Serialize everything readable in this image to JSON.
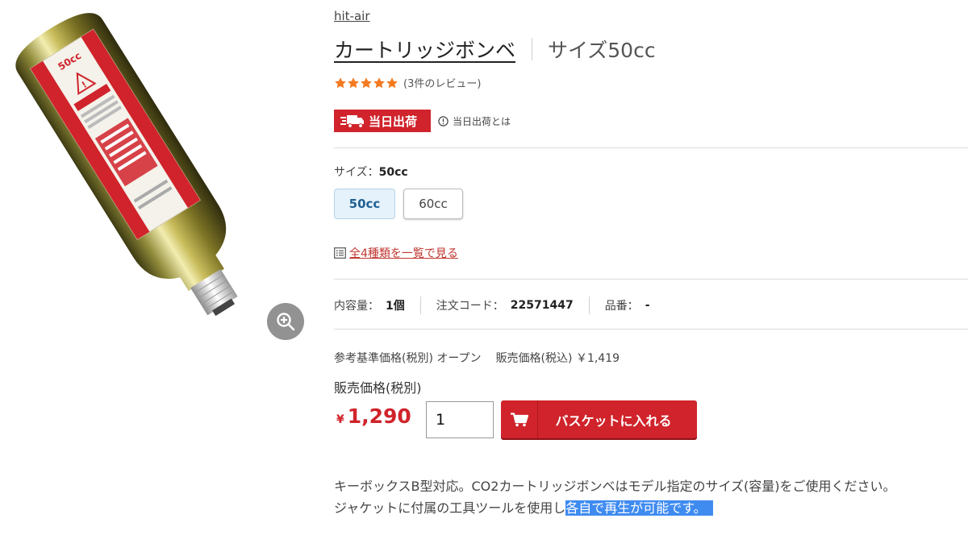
{
  "brand": "hit-air",
  "product": {
    "name": "カートリッジボンベ",
    "variant": "サイズ50cc",
    "image_alt": "CO2カートリッジボンベ"
  },
  "rating": {
    "stars": 5,
    "review_text": "(3件のレビュー)",
    "star_color": "#f47a1f"
  },
  "shipping": {
    "badge": "当日出荷",
    "help": "当日出荷とは",
    "badge_color": "#d0232b"
  },
  "size": {
    "label": "サイズ：",
    "selected": "50cc",
    "options": [
      "50cc",
      "60cc"
    ]
  },
  "all_variants_link": "全4種類を一覧で見る",
  "specs": [
    {
      "label": "内容量：",
      "value": "1個"
    },
    {
      "label": "注文コード：",
      "value": "22571447"
    },
    {
      "label": "品番：",
      "value": "-"
    }
  ],
  "reference_price": {
    "label": "参考基準価格(税別)",
    "value": "オープン",
    "tax_incl_label": "販売価格(税込)",
    "tax_incl_value": "￥1,419"
  },
  "price": {
    "label": "販売価格(税別)",
    "currency": "¥",
    "amount": "1,290"
  },
  "quantity": "1",
  "cart_button": "バスケットに入れる",
  "description": {
    "line1": "キーボックスB型対応。CO2カートリッジボンベはモデル指定のサイズ(容量)をご使用ください。",
    "line2_plain": "ジャケットに付属の工具ツールを使用し",
    "line2_selected": "各自で再生が可能です。"
  },
  "icons": {
    "zoom": "zoom-in-icon",
    "truck": "truck-icon",
    "info": "info-circle-icon",
    "list": "list-icon",
    "cart": "cart-icon"
  },
  "colors": {
    "accent_red": "#d0232b",
    "link_red": "#c0352f",
    "selected_option_bg": "#e5f2fb",
    "selection_highlight": "#3f8bf0"
  }
}
